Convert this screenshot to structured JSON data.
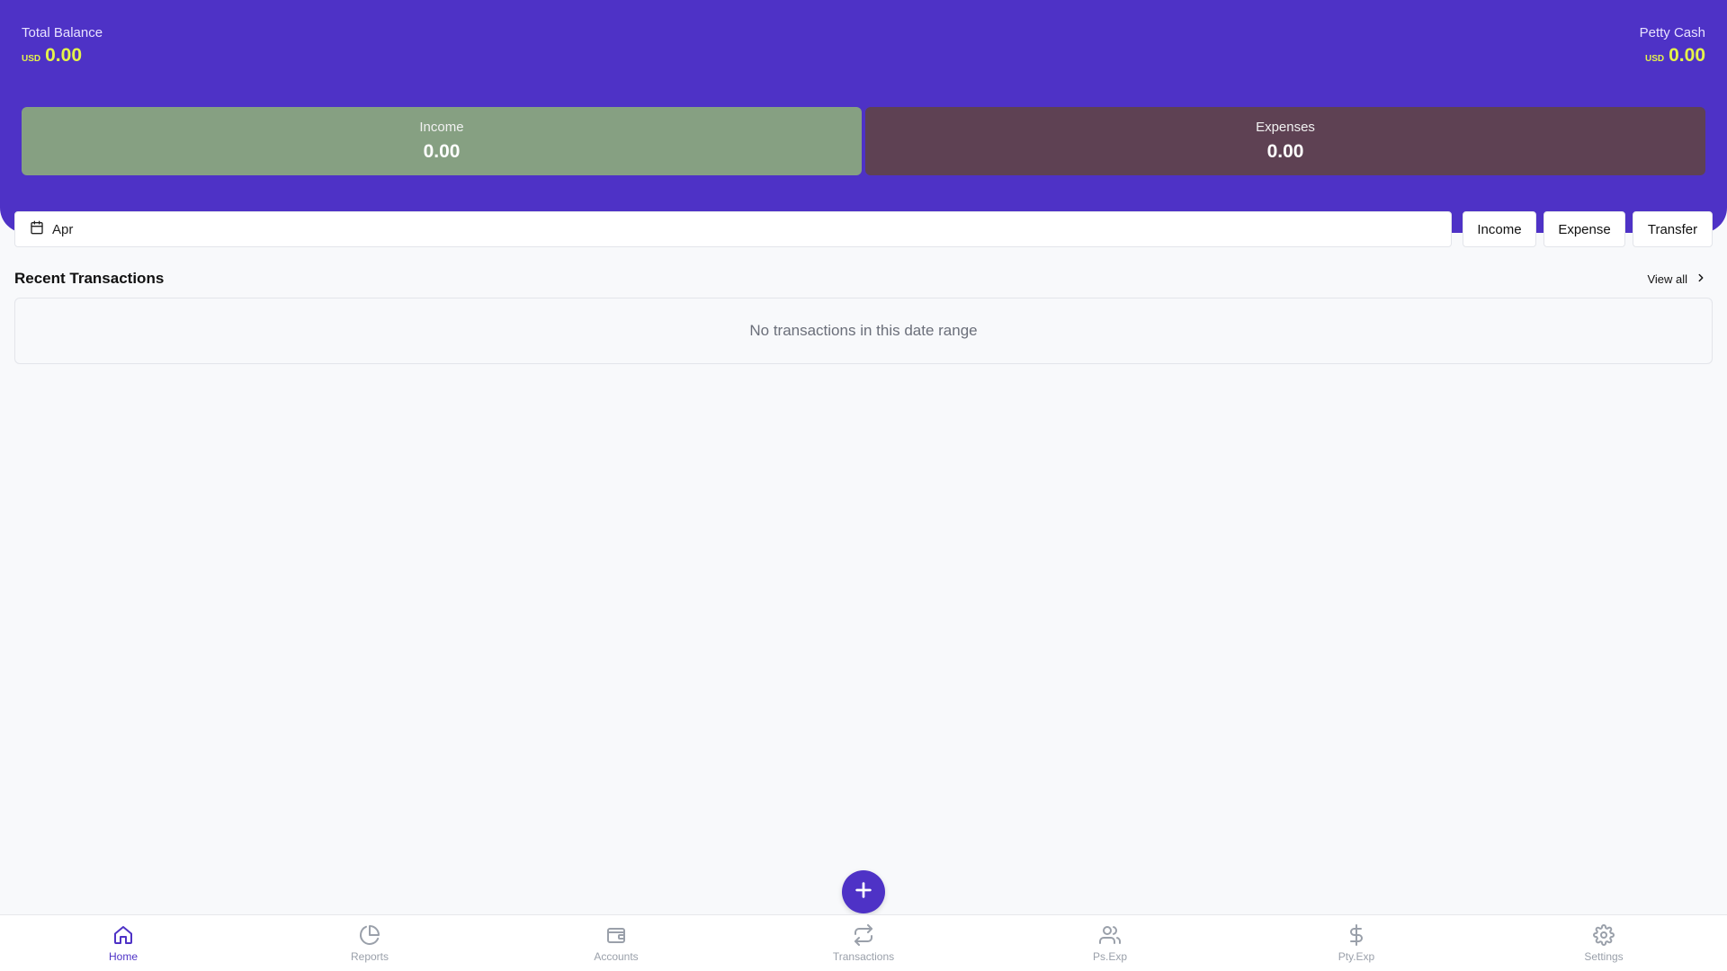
{
  "header": {
    "total_balance": {
      "label": "Total Balance",
      "currency": "USD",
      "amount": "0.00"
    },
    "petty_cash": {
      "label": "Petty Cash",
      "currency": "USD",
      "amount": "0.00"
    },
    "income": {
      "label": "Income",
      "value": "0.00"
    },
    "expenses": {
      "label": "Expenses",
      "value": "0.00"
    }
  },
  "filters": {
    "date_value": "Apr",
    "type_buttons": {
      "income": "Income",
      "expense": "Expense",
      "transfer": "Transfer"
    }
  },
  "recent": {
    "title": "Recent Transactions",
    "view_all": "View all",
    "empty_message": "No transactions in this date range"
  },
  "nav": {
    "items": [
      {
        "label": "Home",
        "icon": "home-icon",
        "active": true
      },
      {
        "label": "Reports",
        "icon": "pie-chart-icon",
        "active": false
      },
      {
        "label": "Accounts",
        "icon": "wallet-icon",
        "active": false
      },
      {
        "label": "Transactions",
        "icon": "repeat-icon",
        "active": false
      },
      {
        "label": "Ps.Exp",
        "icon": "users-icon",
        "active": false
      },
      {
        "label": "Pty.Exp",
        "icon": "dollar-icon",
        "active": false
      },
      {
        "label": "Settings",
        "icon": "gear-icon",
        "active": false
      }
    ]
  },
  "colors": {
    "primary": "#4e32c6",
    "balance_accent": "#e4f34a",
    "income_card": "#86a082",
    "expense_card": "#5e4153",
    "nav_inactive": "#9aa0aa"
  }
}
